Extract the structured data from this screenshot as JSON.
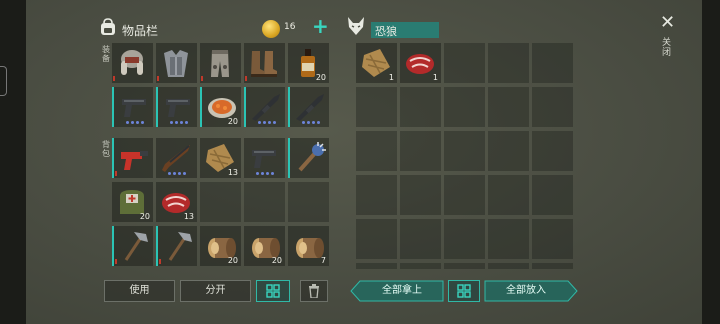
{
  "inventory": {
    "title": "物品栏",
    "coins": "16",
    "add_label": "+"
  },
  "labels": {
    "wear": "装备",
    "backpack": "背包"
  },
  "loot": {
    "title": "恐狼"
  },
  "close": {
    "label": "关闭"
  },
  "buttons": {
    "use": "使用",
    "split": "分开",
    "take_all": "全部拿上",
    "put_all": "全部放入"
  },
  "colors": {
    "accent": "#2bc4b5",
    "wear_marker": "#c0392b",
    "rarity_dots": "#6d84d8"
  },
  "equipment": [
    {
      "item": "fur-hat",
      "count": ""
    },
    {
      "item": "metal-armor",
      "count": ""
    },
    {
      "item": "fur-pants",
      "count": ""
    },
    {
      "item": "leather-boots",
      "count": ""
    },
    {
      "item": "whiskey-bottle",
      "count": "20"
    }
  ],
  "weapons": [
    {
      "item": "pistol",
      "count": ""
    },
    {
      "item": "pistol",
      "count": ""
    },
    {
      "item": "stew-plate",
      "count": "20"
    },
    {
      "item": "rifle",
      "count": ""
    },
    {
      "item": "rifle",
      "count": ""
    }
  ],
  "backpack_rows": [
    [
      {
        "item": "flare-gun",
        "count": ""
      },
      {
        "item": "shotgun",
        "count": ""
      },
      {
        "item": "fiber-bundle",
        "count": "13"
      },
      {
        "item": "pistol",
        "count": ""
      },
      {
        "item": "spiked-club",
        "count": ""
      }
    ],
    [
      {
        "item": "medkit-bag",
        "count": "20"
      },
      {
        "item": "raw-meat",
        "count": "13"
      },
      {
        "item": "",
        "count": ""
      },
      {
        "item": "",
        "count": ""
      },
      {
        "item": "",
        "count": ""
      }
    ],
    [
      {
        "item": "hatchet",
        "count": ""
      },
      {
        "item": "hatchet",
        "count": ""
      },
      {
        "item": "log",
        "count": "20"
      },
      {
        "item": "log",
        "count": "20"
      },
      {
        "item": "log",
        "count": "7"
      }
    ]
  ],
  "loot_items": [
    {
      "item": "fiber-bundle",
      "count": "1"
    },
    {
      "item": "raw-meat",
      "count": "1"
    }
  ]
}
